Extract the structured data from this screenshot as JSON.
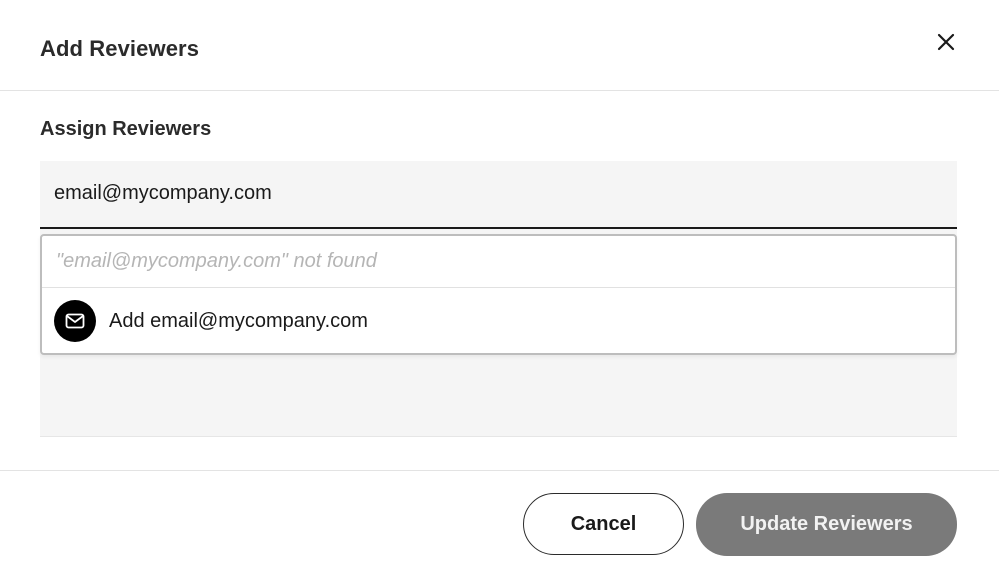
{
  "dialog": {
    "title": "Add Reviewers",
    "close_icon": "close-icon"
  },
  "assign": {
    "label": "Assign Reviewers",
    "input_value": "email@mycompany.com"
  },
  "suggestions": {
    "not_found_text": "\"email@mycompany.com\" not found",
    "add_icon": "mail-icon",
    "add_label": "Add email@mycompany.com"
  },
  "footer": {
    "cancel_label": "Cancel",
    "update_label": "Update Reviewers"
  },
  "colors": {
    "field_background": "#f5f5f5",
    "primary_disabled": "#7a7a7a",
    "text": "#1a1a1a",
    "placeholder": "#b5b5b5"
  }
}
